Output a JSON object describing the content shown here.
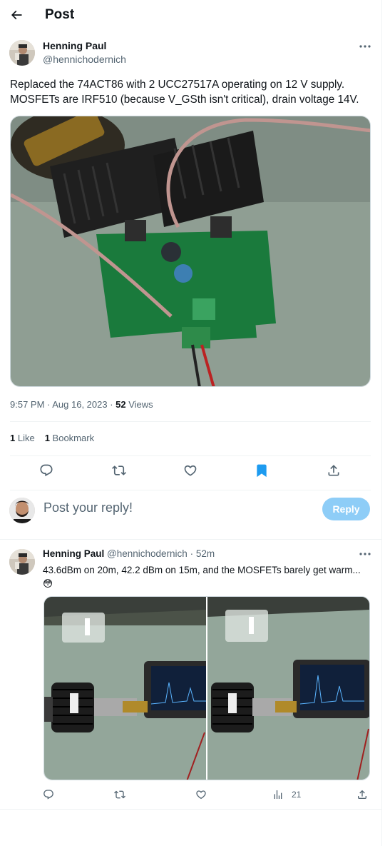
{
  "header": {
    "title": "Post",
    "back_icon": "arrow-left-icon"
  },
  "post": {
    "author_name": "Henning Paul",
    "author_handle": "@hennichodernich",
    "text_lines": [
      "Replaced the 74ACT86 with 2 UCC27517A operating on 12 V supply.",
      "MOSFETs are IRF510 (because V_GSth isn't critical), drain voltage 14V."
    ],
    "time": "9:57 PM · Aug 16, 2023 · ",
    "views_count": "52",
    "views_label": " Views",
    "likes_count": "1",
    "likes_label": " Like",
    "bookmarks_count": "1",
    "bookmarks_label": " Bookmark"
  },
  "actions": [
    "reply-icon",
    "retweet-icon",
    "like-icon",
    "bookmark-icon",
    "share-icon"
  ],
  "reply_box": {
    "placeholder": "Post your reply!",
    "button_label": "Reply"
  },
  "reply": {
    "author_name": "Henning Paul",
    "author_handle": "@hennichodernich",
    "time": "· 52m",
    "text_line1": "43.6dBm on 20m, 42.2 dBm on 15m, and the MOSFETs barely get warm...",
    "text_line2": "😳",
    "views_count": "21"
  },
  "colors": {
    "accent": "#1d9bf0",
    "reply_button": "#8ecdf7",
    "secondary_text": "#536471"
  }
}
